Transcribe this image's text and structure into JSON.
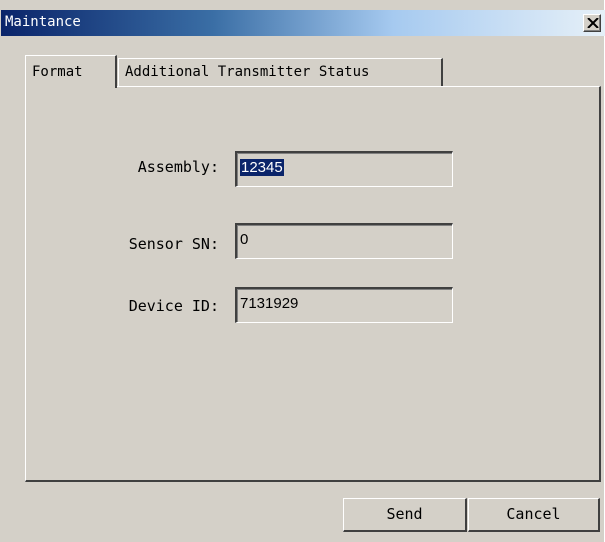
{
  "window": {
    "title": "Maintance",
    "close_icon": "close-x-icon"
  },
  "tabs": [
    {
      "label": "Format",
      "active": true
    },
    {
      "label": "Additional Transmitter Status",
      "active": false
    }
  ],
  "form": {
    "assembly_label": "Assembly:",
    "assembly_value": "12345",
    "sensor_sn_label": "Sensor SN:",
    "sensor_sn_value": "0",
    "device_id_label": "Device ID:",
    "device_id_value": "7131929"
  },
  "buttons": {
    "send": "Send",
    "cancel": "Cancel"
  },
  "colors": {
    "title_gradient_start": "#0a246a",
    "title_gradient_end": "#a6caf0",
    "dialog_face": "#d4d0c8",
    "selection": "#0a246a"
  }
}
